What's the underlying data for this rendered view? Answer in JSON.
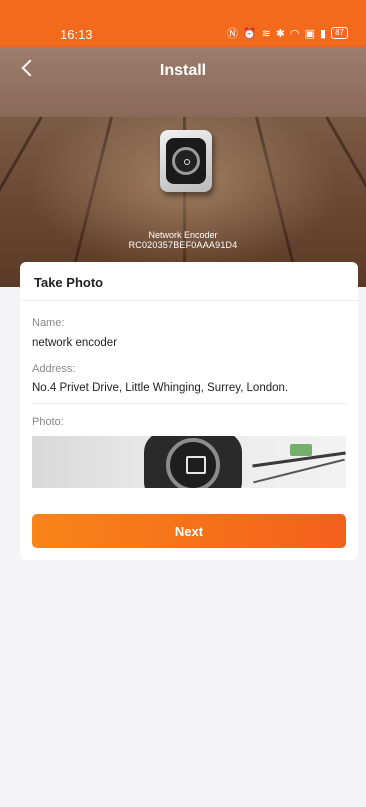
{
  "status_bar": {
    "time": "16:13",
    "icons": [
      "nfc-icon",
      "alarm-icon",
      "vibrate-icon",
      "bluetooth-icon",
      "wifi-icon",
      "hd-icon",
      "signal-icon"
    ],
    "battery": "87"
  },
  "header": {
    "title": "Install"
  },
  "device": {
    "name": "Network Encoder",
    "id": "RC020357BEF0AAA91D4"
  },
  "card": {
    "title": "Take Photo",
    "name_label": "Name:",
    "name_value": "network encoder",
    "address_label": "Address:",
    "address_value": "No.4 Privet Drive, Little Whinging, Surrey, London.",
    "photo_label": "Photo:"
  },
  "actions": {
    "next_label": "Next"
  },
  "colors": {
    "accent": "#f36a1d",
    "button_start": "#f98418",
    "button_end": "#f3601c",
    "background": "#f4f4f6"
  }
}
